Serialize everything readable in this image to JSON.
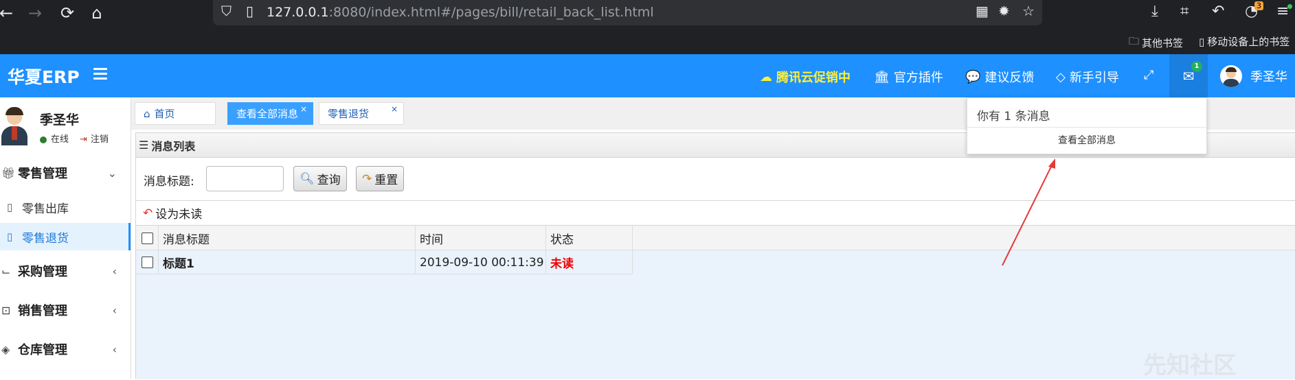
{
  "browser": {
    "url_host": "127.0.0.1",
    "url_rest": ":8080/index.html#/pages/bill/retail_back_list.html",
    "ext_badge": "3",
    "bookmarks": [
      "其他书签",
      "移动设备上的书签"
    ]
  },
  "header": {
    "logo": "华夏ERP",
    "nav": [
      {
        "label": "腾讯云促销中",
        "icon": "cloud-icon"
      },
      {
        "label": "官方插件",
        "icon": "bank-icon"
      },
      {
        "label": "建议反馈",
        "icon": "comment-icon"
      },
      {
        "label": "新手引导",
        "icon": "diamond-icon"
      }
    ],
    "msg_count": "1",
    "user_name": "季圣华",
    "accent": "#1e90ff"
  },
  "sidebar": {
    "user_name": "季圣华",
    "status": "在线",
    "logout": "注销",
    "menus": [
      {
        "label": "零售管理",
        "icon": "gift-icon",
        "expanded": true
      },
      {
        "label": "采购管理",
        "icon": "cart-icon",
        "expanded": false
      },
      {
        "label": "销售管理",
        "icon": "briefcase-icon",
        "expanded": false
      },
      {
        "label": "仓库管理",
        "icon": "layers-icon",
        "expanded": false
      }
    ],
    "sub_items": [
      {
        "label": "零售出库",
        "active": false
      },
      {
        "label": "零售退货",
        "active": true
      }
    ]
  },
  "tabs": [
    {
      "label": "首页",
      "closable": false,
      "active": false
    },
    {
      "label": "查看全部消息",
      "closable": true,
      "active": true
    },
    {
      "label": "零售退货",
      "closable": true,
      "active": false
    }
  ],
  "panel": {
    "title": "消息列表",
    "search_label": "消息标题:",
    "search_value": "",
    "query_btn": "查询",
    "reset_btn": "重置",
    "mark_unread": "设为未读"
  },
  "table": {
    "columns": [
      "消息标题",
      "时间",
      "状态"
    ],
    "rows": [
      {
        "title": "标题1",
        "time": "2019-09-10 00:11:39",
        "status": "未读"
      }
    ]
  },
  "dropdown": {
    "header": "你有 1 条消息",
    "footer": "查看全部消息"
  },
  "watermark": "先知社区"
}
